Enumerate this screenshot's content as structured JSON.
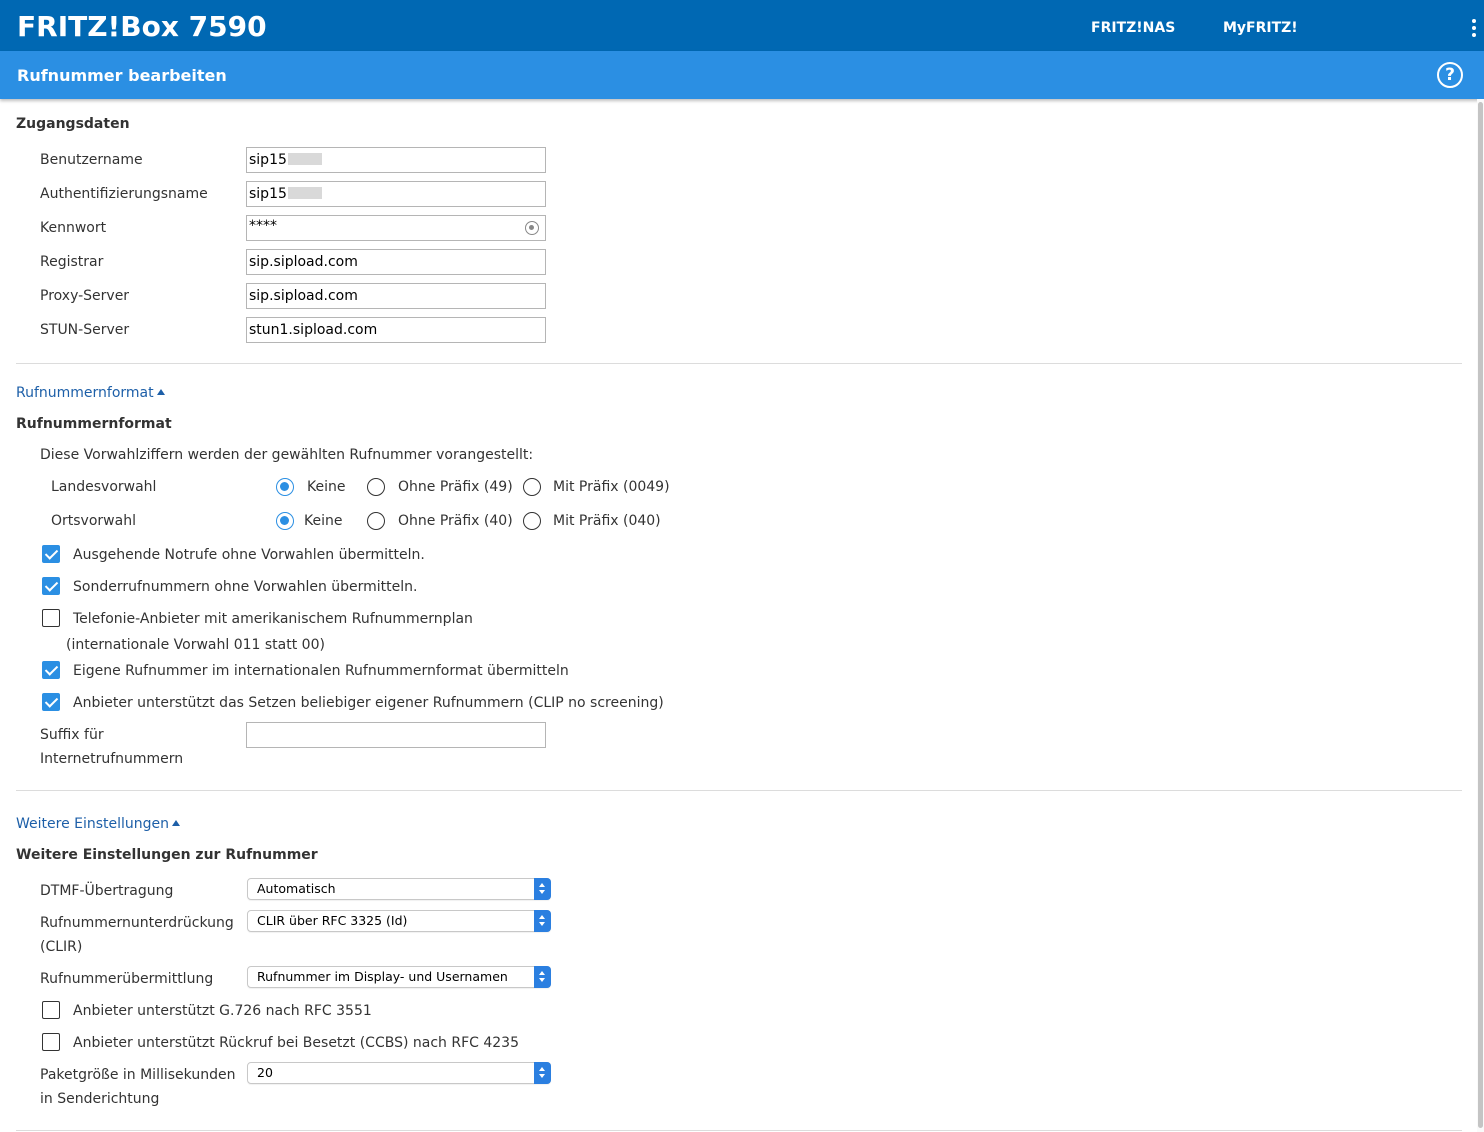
{
  "header": {
    "brand": "FRITZ!Box 7590",
    "links": [
      "FRITZ!NAS",
      "MyFRITZ!"
    ],
    "subtitle": "Rufnummer bearbeiten",
    "help_icon": "?"
  },
  "zugang": {
    "title": "Zugangsdaten",
    "fields": [
      {
        "label": "Benutzername",
        "value": "sip15"
      },
      {
        "label": "Authentifizierungsname",
        "value": "sip15"
      },
      {
        "label": "Kennwort",
        "value": "****"
      },
      {
        "label": "Registrar",
        "value": "sip.sipload.com"
      },
      {
        "label": "Proxy-Server",
        "value": "sip.sipload.com"
      },
      {
        "label": "STUN-Server",
        "value": "stun1.sipload.com"
      }
    ]
  },
  "format": {
    "toggle": "Rufnummernformat",
    "title": "Rufnummernformat",
    "intro": "Diese Vorwahlziffern werden der gewählten Rufnummer vorangestellt:",
    "rows": [
      {
        "label": "Landesvorwahl",
        "options": [
          "Keine",
          "Ohne Präfix (49)",
          "Mit Präfix (0049)"
        ],
        "selected": 0
      },
      {
        "label": "Ortsvorwahl",
        "options": [
          "Keine",
          "Ohne Präfix (40)",
          "Mit Präfix (040)"
        ],
        "selected": 0
      }
    ],
    "checks": [
      {
        "label": "Ausgehende Notrufe ohne Vorwahlen übermitteln.",
        "checked": true
      },
      {
        "label": "Sonderrufnummern ohne Vorwahlen übermitteln.",
        "checked": true
      },
      {
        "label": "Telefonie-Anbieter mit amerikanischem Rufnummernplan",
        "sub": "(internationale Vorwahl 011 statt 00)",
        "checked": false
      },
      {
        "label": "Eigene Rufnummer im internationalen Rufnummernformat übermitteln",
        "checked": true
      },
      {
        "label": "Anbieter unterstützt das Setzen beliebiger eigener Rufnummern (CLIP no screening)",
        "checked": true
      }
    ],
    "suffix_label_1": "Suffix für",
    "suffix_label_2": "Internetrufnummern",
    "suffix_value": ""
  },
  "weitere": {
    "toggle": "Weitere Einstellungen",
    "title": "Weitere Einstellungen zur Rufnummer",
    "selects": [
      {
        "label": "DTMF-Übertragung",
        "value": "Automatisch"
      },
      {
        "label": "Rufnummernunterdrückung",
        "label2": "(CLIR)",
        "value": "CLIR über RFC 3325 (Id)"
      },
      {
        "label": "Rufnummerübermittlung",
        "value": "Rufnummer im Display- und Usernamen"
      }
    ],
    "checks": [
      {
        "label": "Anbieter unterstützt G.726 nach RFC 3551",
        "checked": false
      },
      {
        "label": "Anbieter unterstützt Rückruf bei Besetzt (CCBS) nach RFC 4235",
        "checked": false
      }
    ],
    "packet_label_1": "Paketgröße in Millisekunden",
    "packet_label_2": "in Senderichtung",
    "packet_value": "20"
  },
  "colors": {
    "topbar": "#0068b3",
    "subbar": "#2b8fe3",
    "accent": "#2b8fe3",
    "link": "#1d5fa8"
  }
}
